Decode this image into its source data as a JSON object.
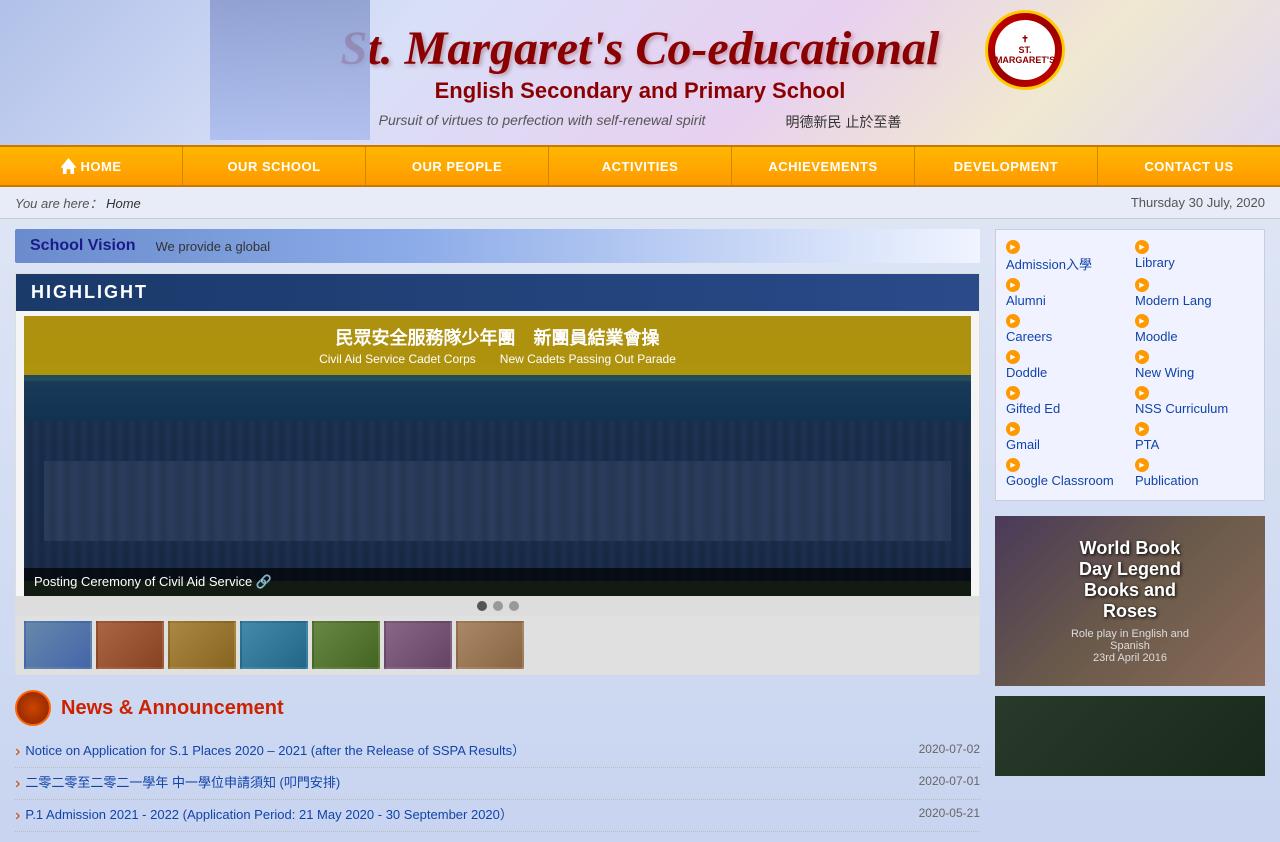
{
  "header": {
    "title_main": "St. Margaret's Co-educational",
    "title_sub": "English Secondary and Primary School",
    "motto_en": "Pursuit of virtues to perfection with self-renewal spirit",
    "motto_zh": "明德新民  止於至善",
    "crest_text": "ST. MARGARET'S"
  },
  "navbar": {
    "items": [
      {
        "id": "home",
        "label": "HOME",
        "icon": "home-icon"
      },
      {
        "id": "our-school",
        "label": "OUR SCHOOL"
      },
      {
        "id": "our-people",
        "label": "OUR PEOPLE"
      },
      {
        "id": "activities",
        "label": "ACTIVITIES"
      },
      {
        "id": "achievements",
        "label": "ACHIEVEMENTS"
      },
      {
        "id": "development",
        "label": "DEVELOPMENT"
      },
      {
        "id": "contact-us",
        "label": "CONTACT US"
      }
    ]
  },
  "breadcrumb": {
    "prefix": "You are here：",
    "current": "Home"
  },
  "date": "Thursday 30 July, 2020",
  "school_vision": {
    "label": "School Vision",
    "text": "We provide a global"
  },
  "highlight": {
    "header": "HIGHLIGHT",
    "main_image_cn": "民眾安全服務隊少年團　新團員結業會操",
    "main_image_en": "Civil Aid Service Cadet Corps　　New Cadets Passing Out Parade",
    "caption": "Posting Ceremony of Civil Aid Service 🔗"
  },
  "news": {
    "section_title": "News & Announcement",
    "items": [
      {
        "text": "Notice on Application for S.1 Places 2020 – 2021 (after the Release of SSPA Results）",
        "date": "2020-07-02"
      },
      {
        "text": "二零二零至二零二一學年 中一學位申請須知 (叩門安排)",
        "date": "2020-07-01"
      },
      {
        "text": "P.1 Admission 2021 - 2022 (Application Period: 21 May 2020 - 30 September 2020）",
        "date": "2020-05-21"
      }
    ]
  },
  "quick_links": {
    "items_left": [
      {
        "id": "admission",
        "label": "Admission入學"
      },
      {
        "id": "alumni",
        "label": "Alumni"
      },
      {
        "id": "careers",
        "label": "Careers"
      },
      {
        "id": "doddle",
        "label": "Doddle"
      },
      {
        "id": "gifted-ed",
        "label": "Gifted Ed"
      },
      {
        "id": "gmail",
        "label": "Gmail"
      },
      {
        "id": "google-classroom",
        "label": "Google Classroom"
      }
    ],
    "items_right": [
      {
        "id": "library",
        "label": "Library"
      },
      {
        "id": "modern-lang",
        "label": "Modern Lang"
      },
      {
        "id": "moodle",
        "label": "Moodle"
      },
      {
        "id": "new-wing",
        "label": "New Wing"
      },
      {
        "id": "nss-curriculum",
        "label": "NSS Curriculum"
      },
      {
        "id": "pta",
        "label": "PTA"
      },
      {
        "id": "publication",
        "label": "Publication"
      }
    ]
  },
  "video1": {
    "title": "World Book Day Legend",
    "subtitle": "Books and Roses",
    "date_text": "Role play in English and Spanish\n23rd April 2016"
  },
  "colors": {
    "accent": "#FF9900",
    "nav_bg": "#FFB700",
    "header_text": "#8B0000",
    "link": "#1144aa"
  }
}
